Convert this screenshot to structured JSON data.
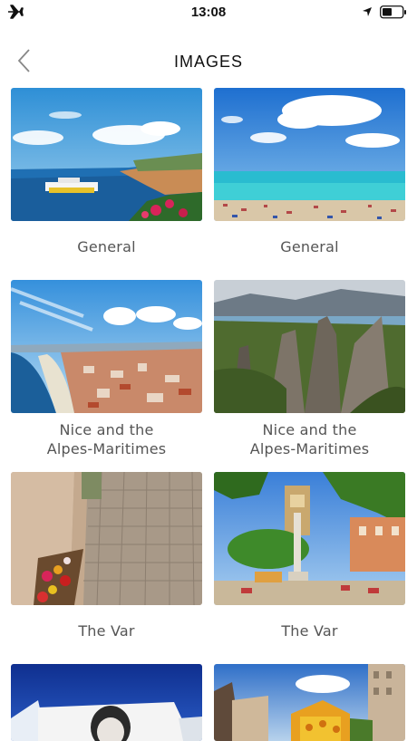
{
  "status_bar": {
    "time": "13:08"
  },
  "header": {
    "title": "IMAGES",
    "back_icon": "chevron-left-icon"
  },
  "gallery": {
    "items": [
      {
        "caption": "General"
      },
      {
        "caption": "General"
      },
      {
        "caption": "Nice and the\nAlpes-Maritimes"
      },
      {
        "caption": "Nice and the\nAlpes-Maritimes"
      },
      {
        "caption": "The Var"
      },
      {
        "caption": "The Var"
      },
      {
        "caption": ""
      },
      {
        "caption": ""
      }
    ]
  },
  "colors": {
    "background": "#ffffff",
    "caption": "#555555",
    "title": "#111111"
  }
}
